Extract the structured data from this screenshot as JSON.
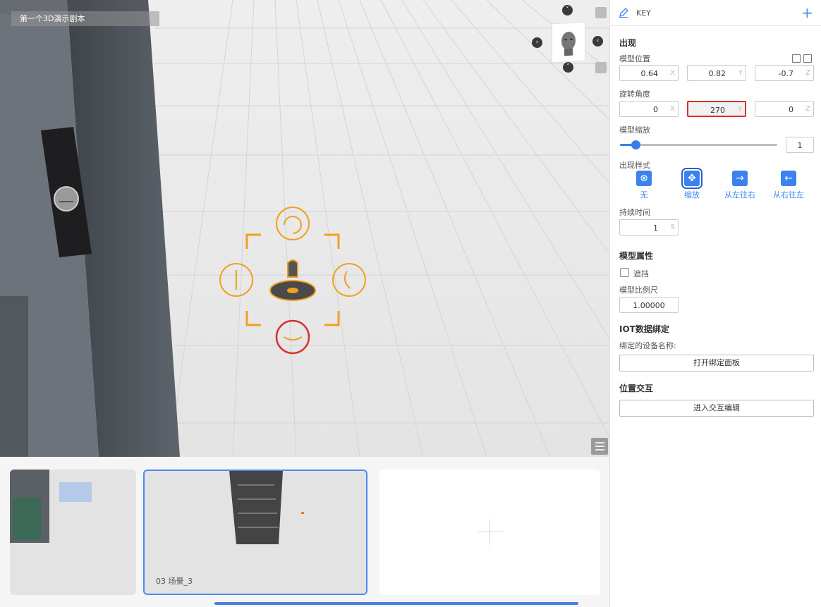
{
  "scene": {
    "title": "第一个3D演示剧本"
  },
  "panel": {
    "object_name": "KEY",
    "appear_section": "出现",
    "position_label": "模型位置",
    "position": {
      "x": "0.64",
      "y": "0.82",
      "z": "-0.7"
    },
    "rotation_label": "旋转角度",
    "rotation": {
      "x": "0",
      "y": "270",
      "z": "0"
    },
    "scale_label": "模型缩放",
    "scale_value": "1",
    "scale_slider_fraction": 0.1,
    "style_label": "出现样式",
    "styles": [
      "无",
      "缩放",
      "从左往右",
      "从右往左"
    ],
    "selected_style": "缩放",
    "duration_label": "持续时间",
    "duration_value": "1",
    "duration_unit": "S",
    "model_attr_section": "模型属性",
    "occlude_label": "遮挡",
    "model_ratio_label": "模型比例尺",
    "model_ratio_value": "1.00000",
    "iot_section": "IOT数据绑定",
    "bound_device_label": "绑定的设备名称:",
    "open_bind_button": "打开绑定面板",
    "interaction_section": "位置交互",
    "enter_interaction_button": "进入交互编辑",
    "axis_labels": {
      "x": "X",
      "y": "Y",
      "z": "Z"
    }
  },
  "thumbnails": [
    {
      "caption": ""
    },
    {
      "caption": "03   场景_3",
      "selected": true
    },
    {
      "caption": ""
    }
  ],
  "colors": {
    "accent": "#3b82f0",
    "gizmo": "#f0a020",
    "error": "#d9302c"
  }
}
